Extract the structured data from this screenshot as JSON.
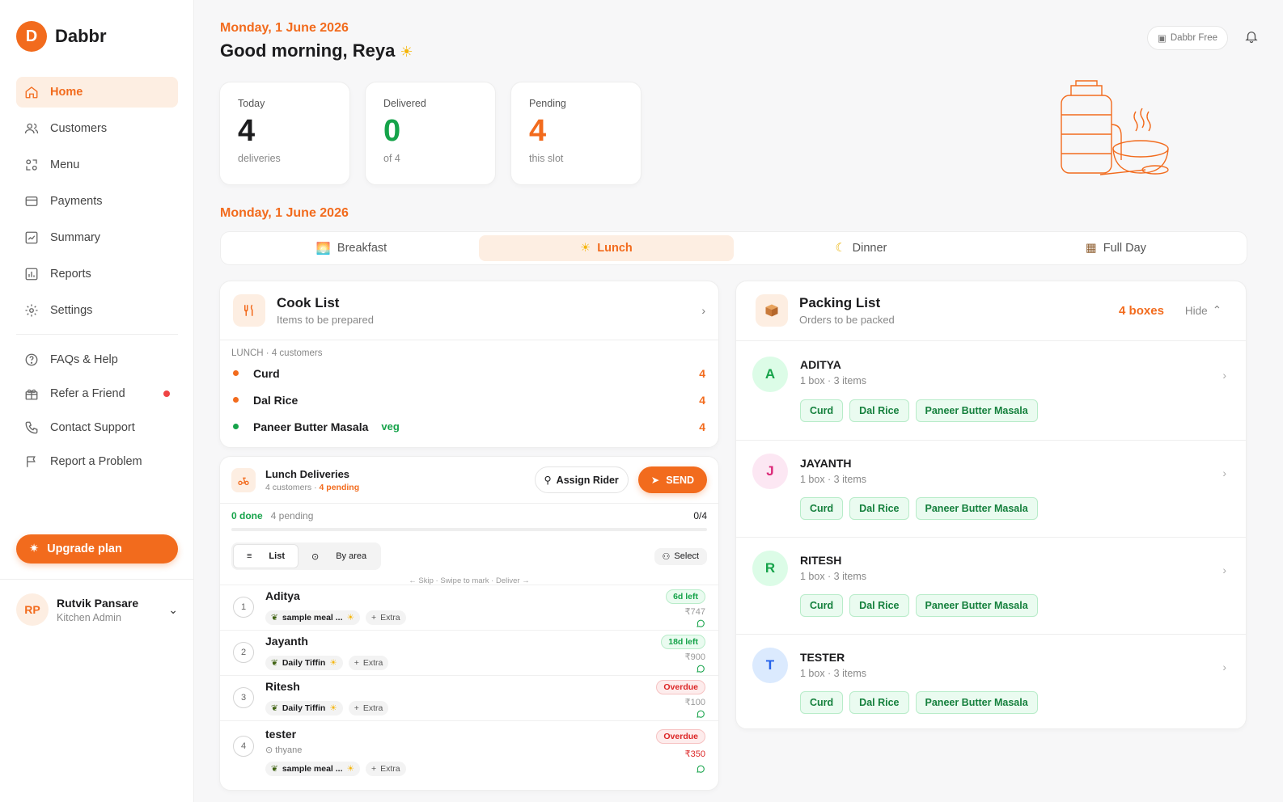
{
  "brand": {
    "logo_letter": "D",
    "name": "Dabbr",
    "color": "#f26b1d"
  },
  "nav": {
    "items": [
      {
        "label": "Home",
        "icon": "home-icon",
        "active": true
      },
      {
        "label": "Customers",
        "icon": "users-icon"
      },
      {
        "label": "Menu",
        "icon": "menu-icon"
      },
      {
        "label": "Payments",
        "icon": "wallet-icon"
      },
      {
        "label": "Summary",
        "icon": "summary-icon"
      },
      {
        "label": "Reports",
        "icon": "reports-icon"
      },
      {
        "label": "Settings",
        "icon": "gear-icon"
      }
    ],
    "secondary": [
      {
        "label": "FAQs & Help",
        "icon": "help-icon"
      },
      {
        "label": "Refer a Friend",
        "icon": "gift-icon",
        "dot": true
      },
      {
        "label": "Contact Support",
        "icon": "phone-icon"
      },
      {
        "label": "Report a Problem",
        "icon": "flag-icon"
      }
    ],
    "upgrade_label": "Upgrade plan"
  },
  "user": {
    "initials": "RP",
    "name": "Rutvik Pansare",
    "role": "Kitchen Admin"
  },
  "header": {
    "date": "Monday, 1 June 2026",
    "greeting": "Good morning, Reya",
    "plan": "Dabbr Free"
  },
  "stats": [
    {
      "label": "Today",
      "value": "4",
      "sub": "deliveries",
      "color": "#1c1c1e"
    },
    {
      "label": "Delivered",
      "value": "0",
      "sub": "of 4",
      "color": "#16a34a"
    },
    {
      "label": "Pending",
      "value": "4",
      "sub": "this slot",
      "color": "#f26b1d"
    }
  ],
  "slot_date": "Monday, 1 June 2026",
  "slots": [
    {
      "label": "Breakfast",
      "icon": "sunrise-icon"
    },
    {
      "label": "Lunch",
      "icon": "sun-icon",
      "active": true
    },
    {
      "label": "Dinner",
      "icon": "moon-icon"
    },
    {
      "label": "Full Day",
      "icon": "calendar-icon"
    }
  ],
  "cook": {
    "title": "Cook List",
    "subtitle": "Items to be prepared",
    "meta": "LUNCH · 4 customers",
    "items": [
      {
        "name": "Curd",
        "count": "4",
        "color": "#f26b1d",
        "tag": ""
      },
      {
        "name": "Dal Rice",
        "count": "4",
        "color": "#f26b1d",
        "tag": ""
      },
      {
        "name": "Paneer Butter Masala",
        "count": "4",
        "color": "#16a34a",
        "tag": "veg"
      }
    ]
  },
  "deliveries": {
    "title": "Lunch Deliveries",
    "customers": "4 customers ·",
    "pending": "4 pending",
    "assign_label": "Assign Rider",
    "send_label": "SEND",
    "done_text": "0 done",
    "pending_text": "4 pending",
    "ratio": "0/4",
    "progress": 0,
    "view_list": "List",
    "view_area": "By area",
    "select_label": "Select",
    "swipe_hint": "← Skip · Swipe to mark · Deliver →",
    "rows": [
      {
        "num": "1",
        "name": "Aditya",
        "location": "",
        "plan": "sample meal ...",
        "extra": "Extra",
        "badge": "6d left",
        "badge_type": "green",
        "amount": "₹747",
        "amount_red": false
      },
      {
        "num": "2",
        "name": "Jayanth",
        "location": "",
        "plan": "Daily Tiffin",
        "extra": "Extra",
        "badge": "18d left",
        "badge_type": "green",
        "amount": "₹900",
        "amount_red": false
      },
      {
        "num": "3",
        "name": "Ritesh",
        "location": "",
        "plan": "Daily Tiffin",
        "extra": "Extra",
        "badge": "Overdue",
        "badge_type": "red",
        "amount": "₹100",
        "amount_red": false
      },
      {
        "num": "4",
        "name": "tester",
        "location": "thyane",
        "plan": "sample meal ...",
        "extra": "Extra",
        "badge": "Overdue",
        "badge_type": "red",
        "amount": "₹350",
        "amount_red": true
      }
    ]
  },
  "packing": {
    "title": "Packing List",
    "subtitle": "Orders to be packed",
    "boxes": "4 boxes",
    "hide_label": "Hide",
    "orders": [
      {
        "initial": "A",
        "name": "ADITYA",
        "meta": "1 box · 3 items",
        "bg": "#dcfce7",
        "fg": "#16a34a",
        "items": [
          "Curd",
          "Dal Rice",
          "Paneer Butter Masala"
        ]
      },
      {
        "initial": "J",
        "name": "JAYANTH",
        "meta": "1 box · 3 items",
        "bg": "#fce7f3",
        "fg": "#db2777",
        "items": [
          "Curd",
          "Dal Rice",
          "Paneer Butter Masala"
        ]
      },
      {
        "initial": "R",
        "name": "RITESH",
        "meta": "1 box · 3 items",
        "bg": "#dcfce7",
        "fg": "#16a34a",
        "items": [
          "Curd",
          "Dal Rice",
          "Paneer Butter Masala"
        ]
      },
      {
        "initial": "T",
        "name": "TESTER",
        "meta": "1 box · 3 items",
        "bg": "#dbeafe",
        "fg": "#2563eb",
        "items": [
          "Curd",
          "Dal Rice",
          "Paneer Butter Masala"
        ]
      }
    ]
  }
}
